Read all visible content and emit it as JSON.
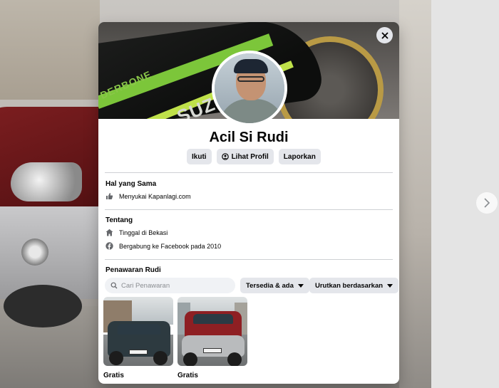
{
  "profile": {
    "name": "Acil Si Rudi",
    "actions": {
      "follow": "Ikuti",
      "view_profile": "Lihat Profil",
      "report": "Laporkan"
    }
  },
  "mutual": {
    "title": "Hal yang Sama",
    "like_prefix": "Menyukai",
    "like_page": "Kapanlagi.com"
  },
  "about": {
    "title": "Tentang",
    "lives_prefix": "Tinggal di",
    "lives_city": "Bekasi",
    "joined": "Bergabung ke Facebook pada 2010"
  },
  "offers": {
    "title": "Penawaran Rudi",
    "search_placeholder": "Cari Penawaran",
    "availability_filter": "Tersedia & ada",
    "sort_filter": "Urutkan berdasarkan",
    "listings": [
      {
        "price": "Gratis",
        "car_color": "#2d3a40"
      },
      {
        "price": "Gratis",
        "car_color": "#8e1f23"
      }
    ]
  },
  "cover": {
    "brand_text": "SUZUKI",
    "sub_text": "DERBONE"
  },
  "icons": {
    "close": "close-icon",
    "next": "chevron-right-icon",
    "like": "thumbs-up-icon",
    "home": "home-icon",
    "facebook": "facebook-icon",
    "search": "search-icon",
    "profile": "user-circle-icon"
  }
}
